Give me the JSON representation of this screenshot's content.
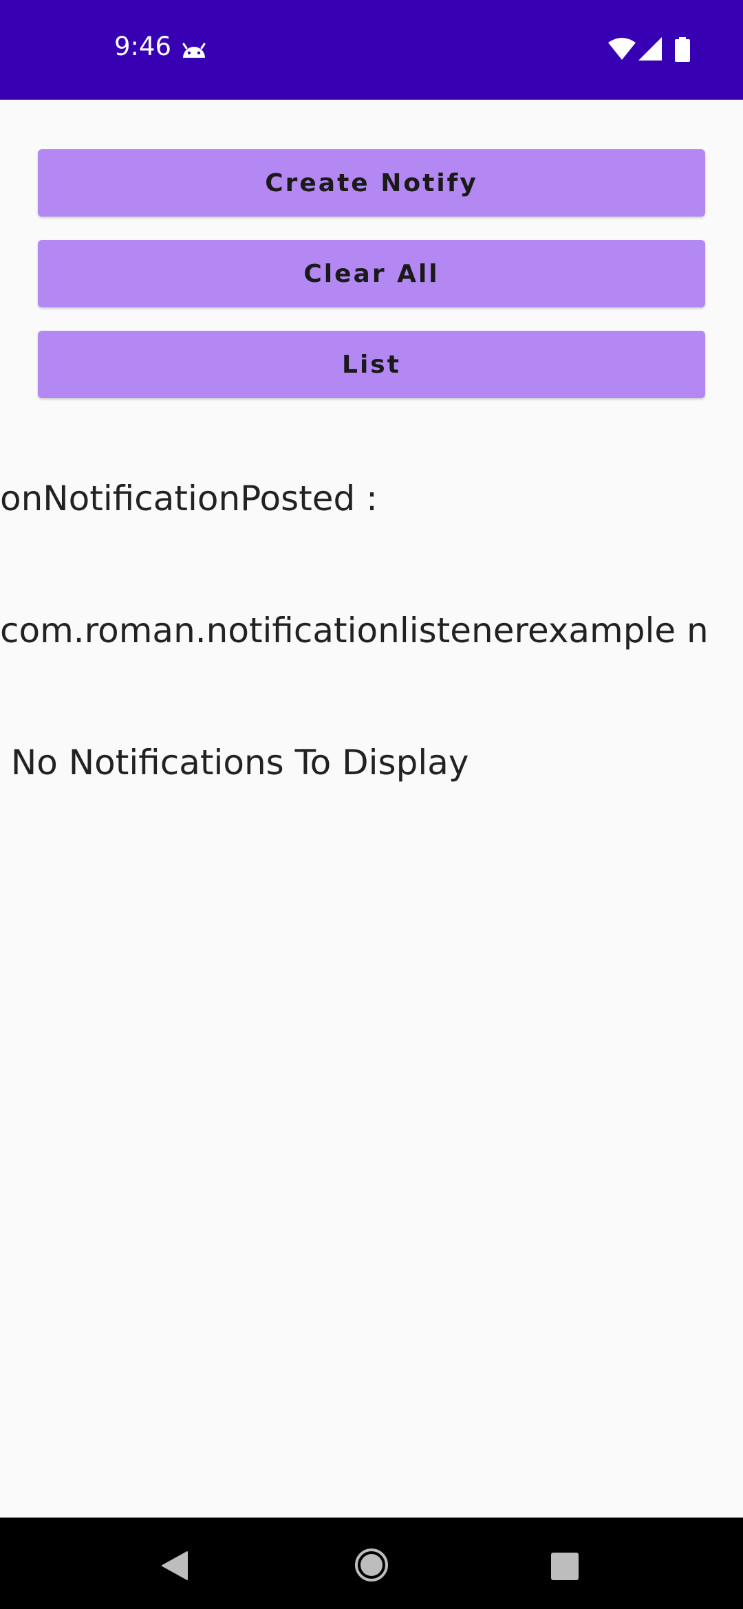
{
  "status_bar": {
    "time": "9:46",
    "background": "#3700b3",
    "icons": [
      "android-icon",
      "wifi-icon",
      "cell-signal-icon",
      "battery-icon"
    ]
  },
  "buttons": {
    "create_notify": "Create Notify",
    "clear_all": "Clear All",
    "list": "List",
    "color": "#b388f2"
  },
  "log": {
    "line1": "onNotificationPosted :",
    "line2": "com.roman.notificationlistenerexample n",
    "line3": " No Notifications To Display"
  },
  "nav_bar": {
    "icons": [
      "back-icon",
      "home-icon",
      "recents-icon"
    ]
  }
}
